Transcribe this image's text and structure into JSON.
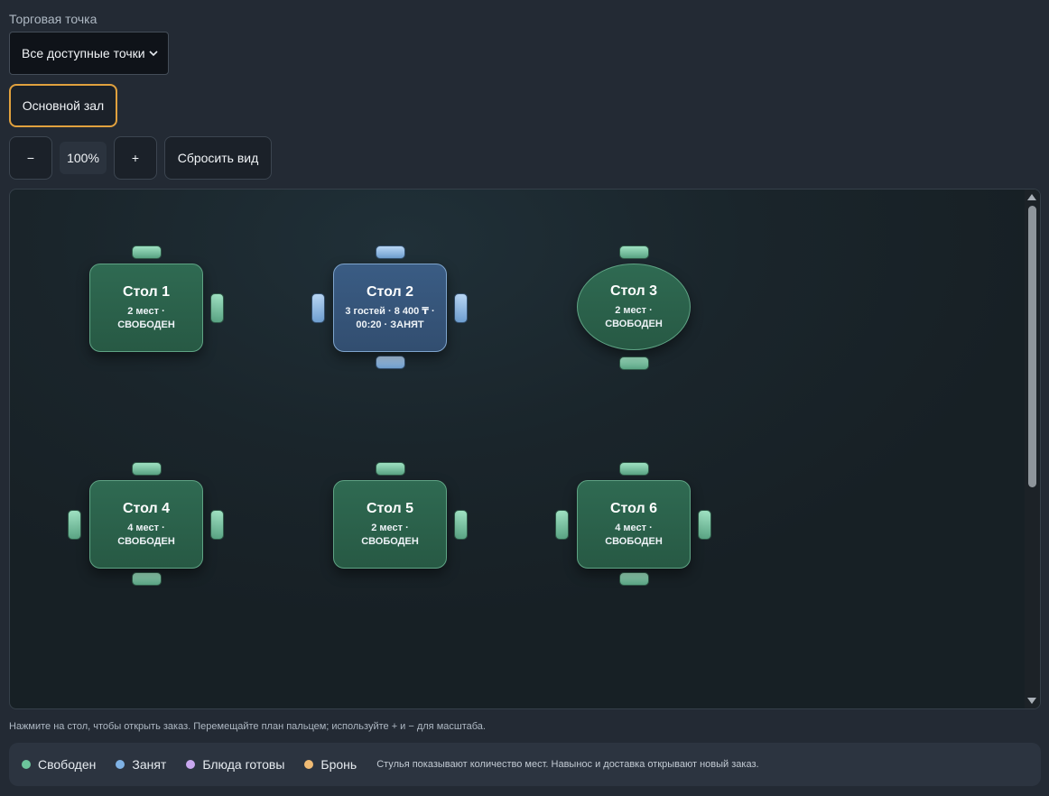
{
  "outlet": {
    "label": "Торговая точка",
    "selected": "Все доступные точки"
  },
  "halls": [
    {
      "label": "Основной зал",
      "active": true
    }
  ],
  "zoom": {
    "minus_label": "−",
    "value": "100%",
    "plus_label": "+",
    "reset_label": "Сбросить вид"
  },
  "tables": [
    {
      "name": "Стол 1",
      "info": "2 мест · СВОБОДЕН",
      "status": "free",
      "shape": "rect",
      "seats": 2
    },
    {
      "name": "Стол 2",
      "info": "3 гостей · 8 400 ₸ · 00:20 · ЗАНЯТ",
      "status": "busy",
      "shape": "rect",
      "seats": 3
    },
    {
      "name": "Стол 3",
      "info": "2 мест · СВОБОДЕН",
      "status": "free",
      "shape": "round",
      "seats": 2
    },
    {
      "name": "Стол 4",
      "info": "4 мест · СВОБОДЕН",
      "status": "free",
      "shape": "rect",
      "seats": 4
    },
    {
      "name": "Стол 5",
      "info": "2 мест · СВОБОДЕН",
      "status": "free",
      "shape": "rect",
      "seats": 2
    },
    {
      "name": "Стол 6",
      "info": "4 мест · СВОБОДЕН",
      "status": "free",
      "shape": "rect",
      "seats": 4
    }
  ],
  "hint": "Нажмите на стол, чтобы открыть заказ. Перемещайте план пальцем; используйте  +  и − для масштаба.",
  "legend": {
    "items": [
      {
        "label": "Свободен",
        "color": "#6cc59c"
      },
      {
        "label": "Занят",
        "color": "#7fb2e5"
      },
      {
        "label": "Блюда готовы",
        "color": "#c9a7ef"
      },
      {
        "label": "Бронь",
        "color": "#f0bb74"
      }
    ],
    "note": "Стулья показывают количество мест. Навынос и доставка открывают новый заказ."
  },
  "colors": {
    "free": "#2f6a52",
    "busy": "#3a5c84",
    "accent": "#e1a13e"
  }
}
